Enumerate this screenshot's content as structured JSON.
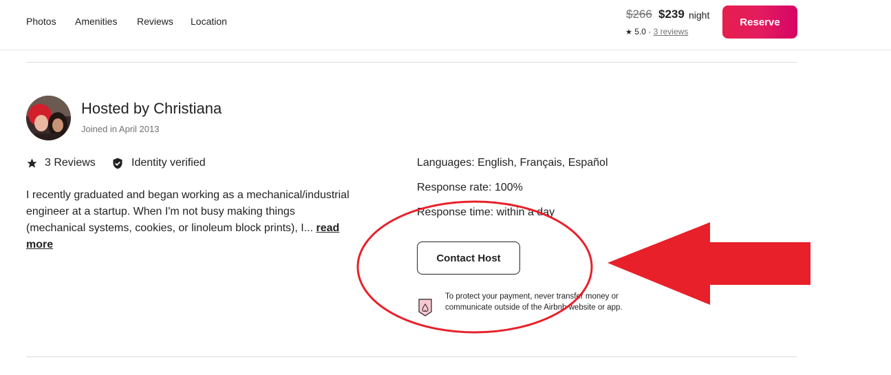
{
  "nav": {
    "links": [
      "Photos",
      "Amenities",
      "Reviews",
      "Location"
    ]
  },
  "booking": {
    "price_original": "$266",
    "price_current": "$239",
    "price_unit": "night",
    "rating": "5.0",
    "rating_separator": "·",
    "reviews_link": "3 reviews",
    "reserve_label": "Reserve"
  },
  "host": {
    "title": "Hosted by Christiana",
    "joined": "Joined in April 2013",
    "reviews_count": "3 Reviews",
    "identity": "Identity verified",
    "bio": "I recently graduated and began working as a mechanical/industrial engineer at a startup. When I'm not busy making things (mechanical systems, cookies, or linoleum block prints), I...",
    "read_more": "read more",
    "languages": "Languages: English, Français, Español",
    "response_rate": "Response rate: 100%",
    "response_time": "Response time: within a day",
    "contact_label": "Contact Host",
    "payment_notice": "To protect your payment, never transfer money or communicate outside of the Airbnb website or app."
  },
  "icons": {
    "star": "star-icon",
    "shield": "shield-check-icon",
    "protect": "airbnb-protect-icon"
  },
  "colors": {
    "brand": "#e31c5f",
    "annotation": "#e8202a"
  }
}
